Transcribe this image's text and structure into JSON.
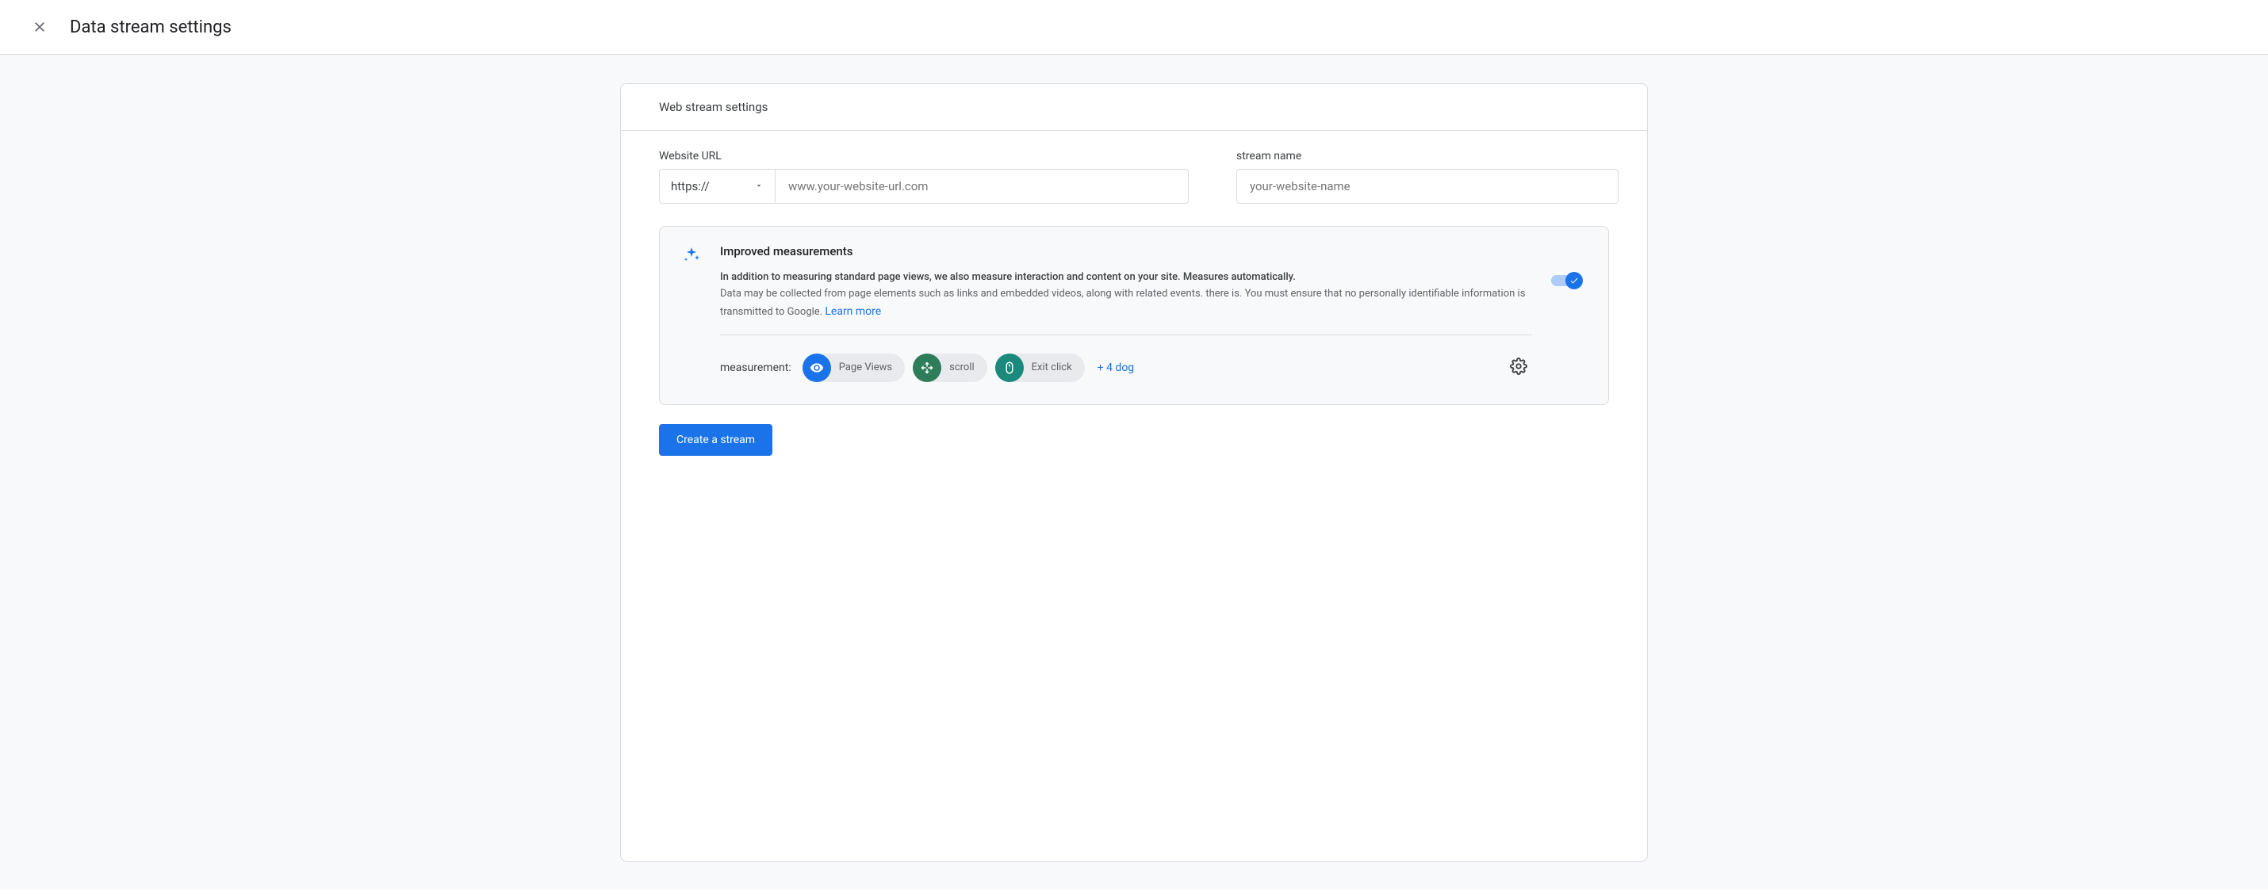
{
  "header": {
    "title": "Data stream settings"
  },
  "card": {
    "heading": "Web stream settings",
    "url": {
      "label": "Website URL",
      "protocol": "https://",
      "placeholder": "www.your-website-url.com",
      "value": ""
    },
    "name": {
      "label": "stream name",
      "placeholder": "your-website-name",
      "value": ""
    },
    "panel": {
      "title": "Improved measurements",
      "bold_line": "In addition to measuring standard page views, we also measure interaction and content on your site. Measures automatically.",
      "body_line": "Data may be collected from page elements such as links and embedded videos, along with related events. there is. You must ensure that no personally identifiable information is transmitted to Google.",
      "learn_more": "Learn more",
      "toggle_on": true,
      "measurement_label": "measurement:",
      "chips": [
        {
          "label": "Page Views",
          "icon": "eye",
          "color": "blue"
        },
        {
          "label": "scroll",
          "icon": "scroll",
          "color": "green"
        },
        {
          "label": "Exit click",
          "icon": "mouse",
          "color": "teal"
        }
      ],
      "more": "+ 4 dog"
    },
    "button": "Create a stream"
  }
}
